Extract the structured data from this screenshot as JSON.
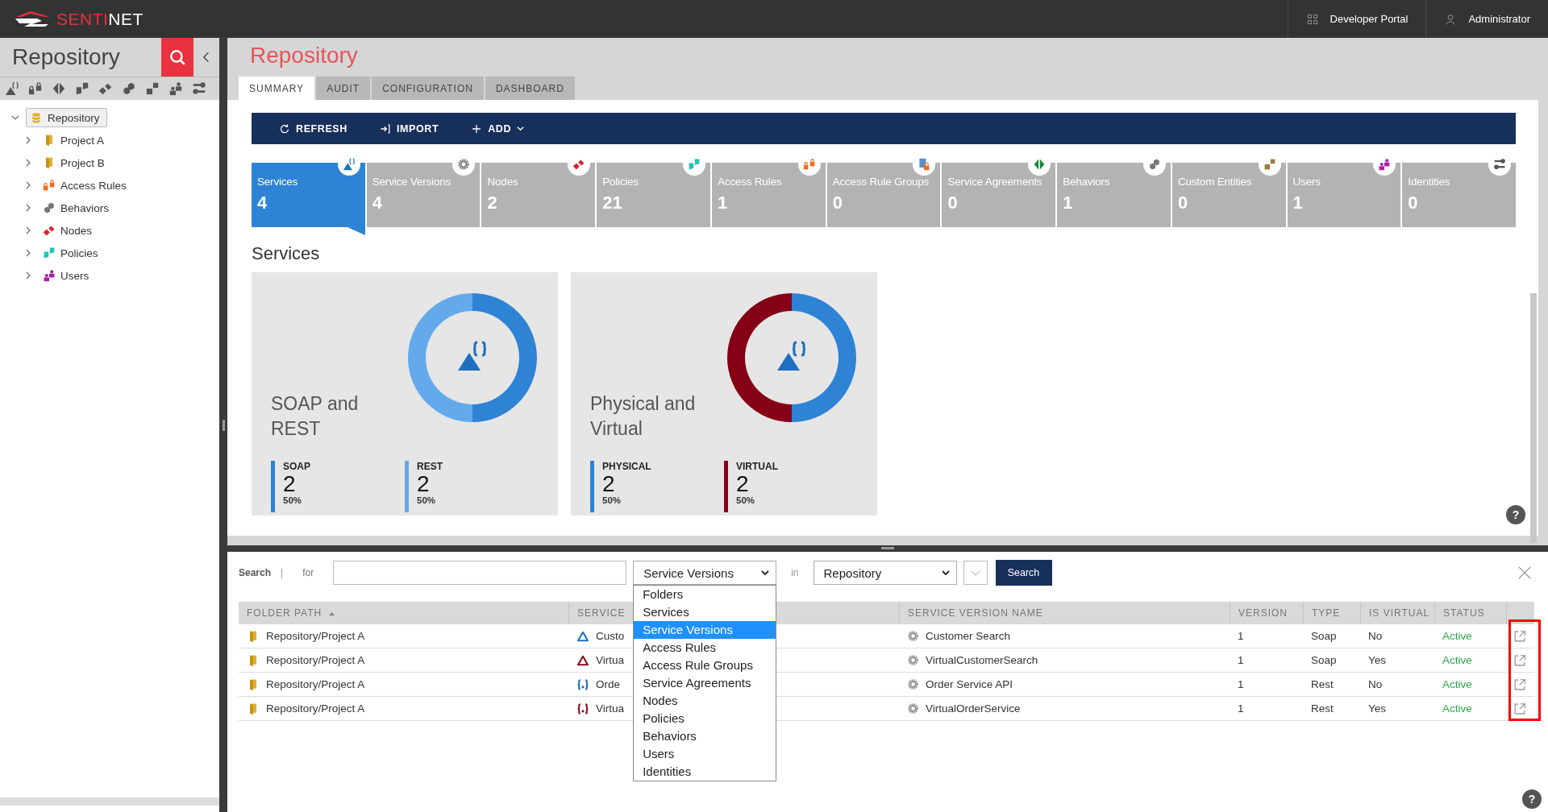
{
  "header": {
    "brand": {
      "accent": "SENTI",
      "rest": "NET"
    },
    "links": [
      {
        "kind": "portal",
        "label": "Developer Portal"
      },
      {
        "kind": "account",
        "label": "Administrator"
      }
    ]
  },
  "sidebar": {
    "title": "Repository",
    "tree": [
      {
        "label": "Repository",
        "kind": "repository",
        "expanded": true,
        "selected": true,
        "children": [
          {
            "label": "Project A",
            "kind": "folder",
            "expanded": false,
            "selected": false
          },
          {
            "label": "Project B",
            "kind": "folder",
            "expanded": false,
            "selected": false
          },
          {
            "label": "Access Rules",
            "kind": "access_rules",
            "expanded": false,
            "selected": false
          },
          {
            "label": "Behaviors",
            "kind": "behaviors",
            "expanded": false,
            "selected": false
          },
          {
            "label": "Nodes",
            "kind": "nodes",
            "expanded": false,
            "selected": false
          },
          {
            "label": "Policies",
            "kind": "policies",
            "expanded": false,
            "selected": false
          },
          {
            "label": "Users",
            "kind": "users",
            "expanded": false,
            "selected": false
          }
        ]
      }
    ]
  },
  "page": {
    "title": "Repository",
    "tabs": [
      {
        "label": "SUMMARY",
        "selected": true
      },
      {
        "label": "AUDIT",
        "selected": false
      },
      {
        "label": "CONFIGURATION",
        "selected": false
      },
      {
        "label": "DASHBOARD",
        "selected": false
      }
    ],
    "toolbar": [
      {
        "kind": "refresh",
        "label": "REFRESH",
        "menu": false
      },
      {
        "kind": "import",
        "label": "IMPORT",
        "menu": false
      },
      {
        "kind": "add",
        "label": "ADD",
        "menu": true
      }
    ],
    "tiles": [
      {
        "label": "Services",
        "count": "4",
        "kind": "services",
        "selected": true
      },
      {
        "label": "Service Versions",
        "count": "4",
        "kind": "service_versions",
        "selected": false
      },
      {
        "label": "Nodes",
        "count": "2",
        "kind": "nodes",
        "selected": false
      },
      {
        "label": "Policies",
        "count": "21",
        "kind": "policies",
        "selected": false
      },
      {
        "label": "Access Rules",
        "count": "1",
        "kind": "access_rules",
        "selected": false
      },
      {
        "label": "Access Rule Groups",
        "count": "0",
        "kind": "access_rule_groups",
        "selected": false
      },
      {
        "label": "Service Agreements",
        "count": "0",
        "kind": "service_agreements",
        "selected": false
      },
      {
        "label": "Behaviors",
        "count": "1",
        "kind": "behaviors",
        "selected": false
      },
      {
        "label": "Custom Entities",
        "count": "0",
        "kind": "custom_entities",
        "selected": false
      },
      {
        "label": "Users",
        "count": "1",
        "kind": "users",
        "selected": false
      },
      {
        "label": "Identities",
        "count": "0",
        "kind": "identities",
        "selected": false
      }
    ],
    "section_title": "Services",
    "cards": [
      {
        "title": "SOAP and REST",
        "chart_data": {
          "type": "donut",
          "categories": [
            "SOAP",
            "REST"
          ],
          "values": [
            50,
            50
          ]
        },
        "legend": [
          {
            "count": "2",
            "percent": "50%",
            "color": "#2f83d5"
          },
          {
            "count": "2",
            "percent": "50%",
            "color": "#63a9ec"
          }
        ]
      },
      {
        "title": "Physical and Virtual",
        "chart_data": {
          "type": "donut",
          "categories": [
            "PHYSICAL",
            "VIRTUAL"
          ],
          "values": [
            50,
            50
          ]
        },
        "legend": [
          {
            "count": "2",
            "percent": "50%",
            "color": "#2f83d5"
          },
          {
            "count": "2",
            "percent": "50%",
            "color": "#850016"
          }
        ]
      }
    ],
    "help": "?"
  },
  "search": {
    "label": "Search",
    "separator": "|",
    "for_label": "for",
    "type_select": {
      "value": "Service Versions",
      "options": [
        {
          "label": "Folders",
          "selected": false
        },
        {
          "label": "Services",
          "selected": false
        },
        {
          "label": "Service Versions",
          "selected": true
        },
        {
          "label": "Access Rules",
          "selected": false
        },
        {
          "label": "Access Rule Groups",
          "selected": false
        },
        {
          "label": "Service Agreements",
          "selected": false
        },
        {
          "label": "Nodes",
          "selected": false
        },
        {
          "label": "Policies",
          "selected": false
        },
        {
          "label": "Behaviors",
          "selected": false
        },
        {
          "label": "Users",
          "selected": false
        },
        {
          "label": "Identities",
          "selected": false
        }
      ]
    },
    "in_label": "in",
    "scope_select": {
      "value": "Repository"
    },
    "button": "Search"
  },
  "table": {
    "columns": [
      {
        "label": "FOLDER PATH",
        "sorted": true
      },
      {
        "label": "SERVICE",
        "sorted": false
      },
      {
        "label": "SERVICE VERSION NAME",
        "sorted": false
      },
      {
        "label": "VERSION",
        "sorted": false
      },
      {
        "label": "TYPE",
        "sorted": false
      },
      {
        "label": "IS VIRTUAL",
        "sorted": false
      },
      {
        "label": "STATUS",
        "sorted": false
      }
    ],
    "rows": [
      {
        "folder_path": "Repository/Project A",
        "service": {
          "name": "Custo",
          "kind": "soap",
          "color": "#1f6fbf"
        },
        "version_name": "Customer Search",
        "version": "1",
        "type": "Soap",
        "is_virtual": "No",
        "status": "Active"
      },
      {
        "folder_path": "Repository/Project A",
        "service": {
          "name": "Virtua",
          "kind": "soap",
          "color": "#8a1020"
        },
        "version_name": "VirtualCustomerSearch",
        "version": "1",
        "type": "Soap",
        "is_virtual": "Yes",
        "status": "Active"
      },
      {
        "folder_path": "Repository/Project A",
        "service": {
          "name": "Orde",
          "kind": "rest",
          "color": "#1f6fbf"
        },
        "version_name": "Order Service API",
        "version": "1",
        "type": "Rest",
        "is_virtual": "No",
        "status": "Active"
      },
      {
        "folder_path": "Repository/Project A",
        "service": {
          "name": "Virtua",
          "kind": "rest",
          "color": "#8a1020"
        },
        "version_name": "VirtualOrderService",
        "version": "1",
        "type": "Rest",
        "is_virtual": "Yes",
        "status": "Active"
      }
    ],
    "highlight_last_column": true
  },
  "help": "?"
}
